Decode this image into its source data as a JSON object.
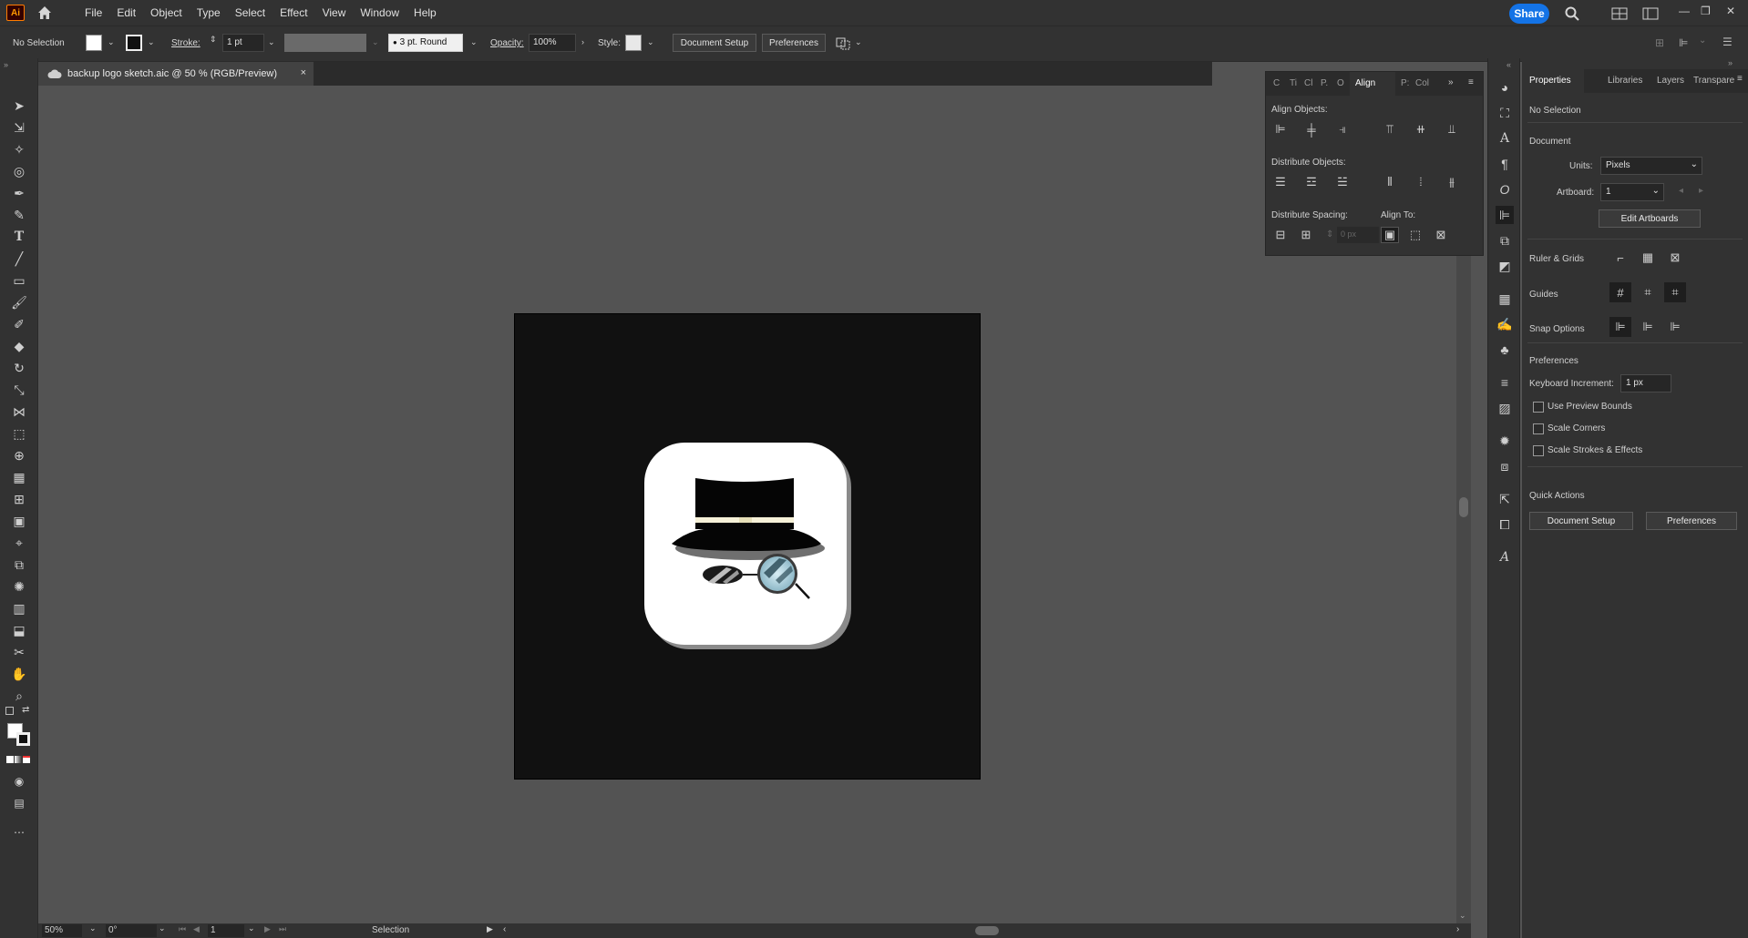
{
  "menubar": {
    "app_logo": "Ai",
    "items": [
      "File",
      "Edit",
      "Object",
      "Type",
      "Select",
      "Effect",
      "View",
      "Window",
      "Help"
    ],
    "share_label": "Share"
  },
  "controlbar": {
    "selection_status": "No Selection",
    "stroke_label": "Stroke:",
    "stroke_weight": "1 pt",
    "brush_profile": "3 pt. Round",
    "opacity_label": "Opacity:",
    "opacity_value": "100%",
    "style_label": "Style:",
    "document_setup_label": "Document Setup",
    "preferences_label": "Preferences"
  },
  "document_tab": {
    "title": "backup logo sketch.aic @ 50 % (RGB/Preview)",
    "close_glyph": "×"
  },
  "statusbar": {
    "zoom": "50%",
    "rotation": "0°",
    "artboard_number": "1",
    "tool_name": "Selection"
  },
  "align_panel": {
    "tabs": [
      "C",
      "Ti",
      "Cl",
      "P.",
      "O",
      "Align",
      "P:",
      "Col"
    ],
    "active_tab": "Align",
    "align_objects_label": "Align Objects:",
    "distribute_objects_label": "Distribute Objects:",
    "distribute_spacing_label": "Distribute Spacing:",
    "align_to_label": "Align To:",
    "spacing_value": "0 px"
  },
  "properties_panel": {
    "tabs": [
      "Properties",
      "Libraries",
      "Layers",
      "Transpare"
    ],
    "active_tab": "Properties",
    "selection_status": "No Selection",
    "document_heading": "Document",
    "units_label": "Units:",
    "units_value": "Pixels",
    "artboard_label": "Artboard:",
    "artboard_value": "1",
    "edit_artboards_label": "Edit Artboards",
    "ruler_grids_label": "Ruler & Grids",
    "guides_label": "Guides",
    "snap_options_label": "Snap Options",
    "preferences_heading": "Preferences",
    "keyboard_increment_label": "Keyboard Increment:",
    "keyboard_increment_value": "1 px",
    "use_preview_bounds_label": "Use Preview Bounds",
    "scale_corners_label": "Scale Corners",
    "scale_strokes_label": "Scale Strokes & Effects",
    "quick_actions_heading": "Quick Actions",
    "document_setup_label": "Document Setup",
    "preferences_label": "Preferences"
  },
  "colors": {
    "accent": "#1473e6",
    "ui_dark": "#323232",
    "canvas": "#535353",
    "artboard": "#111111"
  }
}
